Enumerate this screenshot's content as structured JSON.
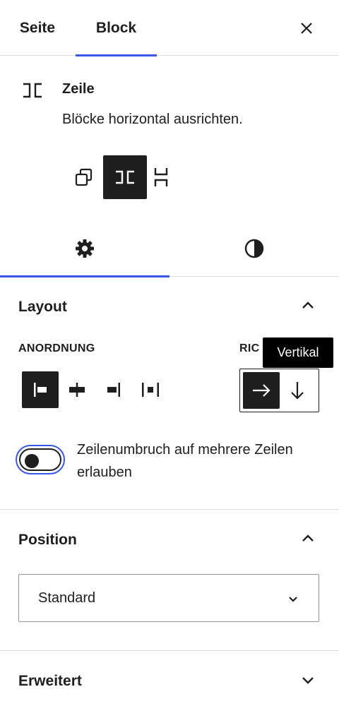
{
  "tabs": {
    "page": "Seite",
    "block": "Block"
  },
  "block": {
    "title": "Zeile",
    "description": "Blöcke horizontal ausrichten."
  },
  "variations": [
    "group-icon",
    "row-icon",
    "stack-icon"
  ],
  "subtabs": [
    "settings-gear-icon",
    "styles-contrast-icon"
  ],
  "layout": {
    "title": "Layout",
    "justification_label": "ANORDNUNG",
    "orientation_label": "RIC",
    "tooltip": "Vertikal",
    "wrap_toggle_label": "Zeilenumbruch auf mehrere Zeilen erlauben",
    "wrap_enabled": false
  },
  "position": {
    "title": "Position",
    "selected": "Standard"
  },
  "advanced": {
    "title": "Erweitert"
  },
  "colors": {
    "accent": "#3858e9",
    "text": "#1e1e1e",
    "border": "#e0e0e0"
  }
}
